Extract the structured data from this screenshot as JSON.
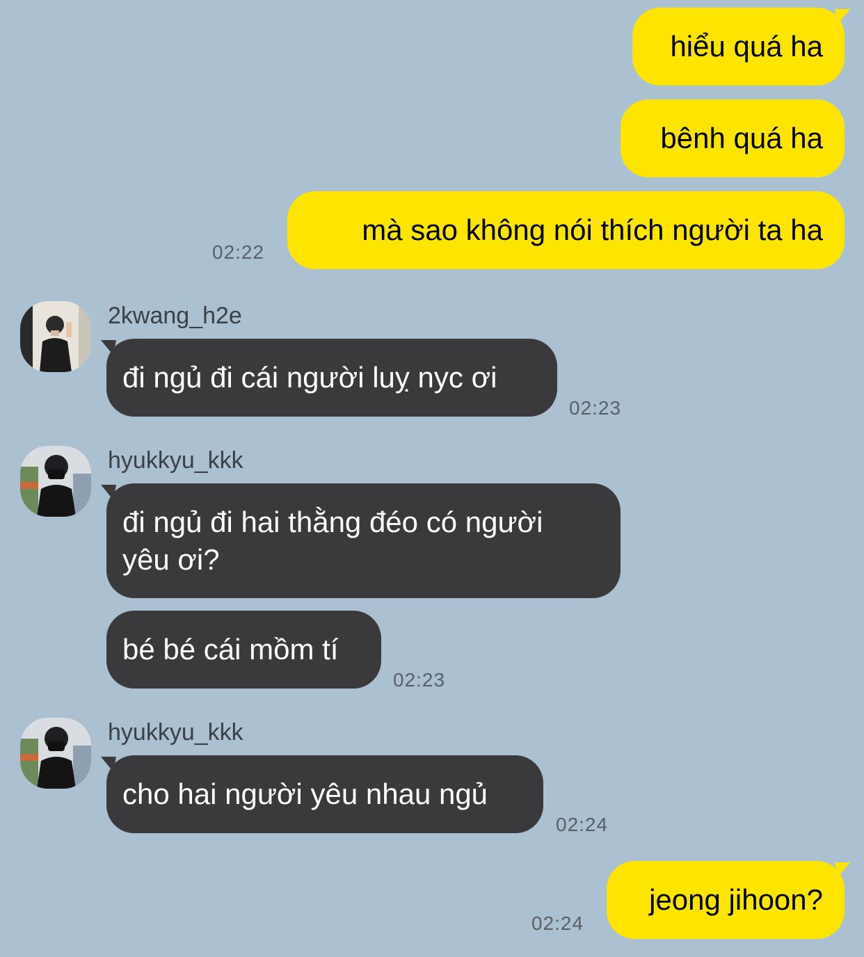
{
  "outgoing_top": [
    {
      "text": "hiểu quá ha"
    },
    {
      "text": "bênh quá ha"
    },
    {
      "text": "mà sao không nói thích người ta ha",
      "time": "02:22"
    }
  ],
  "group1": {
    "sender": "2kwang_h2e",
    "messages": [
      "đi ngủ đi cái người luỵ nyc ơi"
    ],
    "time": "02:23"
  },
  "group2": {
    "sender": "hyukkyu_kkk",
    "messages": [
      "đi ngủ đi hai thằng đéo có người",
      "yêu ơi?",
      "bé bé cái mồm tí"
    ],
    "time": "02:23"
  },
  "group3": {
    "sender": "hyukkyu_kkk",
    "messages": [
      "cho hai người yêu nhau ngủ"
    ],
    "time": "02:24"
  },
  "outgoing_bottom": {
    "text": "jeong jihoon?",
    "time": "02:24"
  },
  "colors": {
    "background": "#abc1d1",
    "outgoing_bubble": "#fee500",
    "incoming_bubble": "#3a3a3c",
    "timestamp": "#595f66"
  }
}
